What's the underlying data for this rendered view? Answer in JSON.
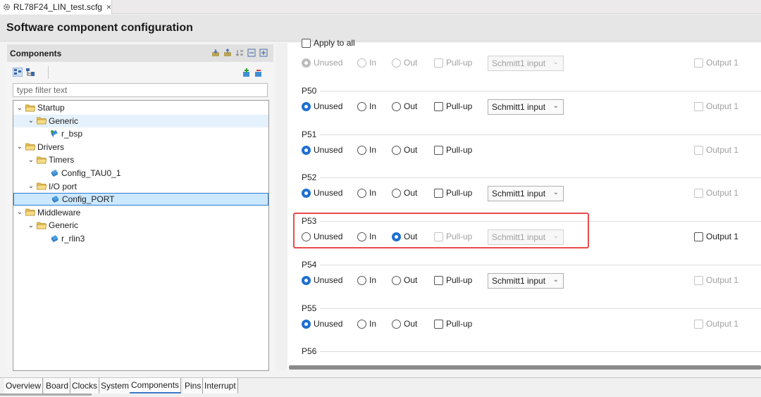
{
  "tab": {
    "title": "RL78F24_LIN_test.scfg",
    "close_symbol": "×"
  },
  "header": {
    "title": "Software component configuration"
  },
  "components": {
    "title": "Components",
    "filter_placeholder": "type filter text",
    "tree": [
      {
        "label": "Startup",
        "chev": "⌄",
        "kind": "folder"
      },
      {
        "label": "Generic",
        "chev": "⌄",
        "kind": "folder"
      },
      {
        "label": "r_bsp",
        "chev": "",
        "kind": "bsp"
      },
      {
        "label": "Drivers",
        "chev": "⌄",
        "kind": "folder"
      },
      {
        "label": "Timers",
        "chev": "⌄",
        "kind": "folder"
      },
      {
        "label": "Config_TAU0_1",
        "chev": "",
        "kind": "config"
      },
      {
        "label": "I/O port",
        "chev": "⌄",
        "kind": "folder"
      },
      {
        "label": "Config_PORT",
        "chev": "",
        "kind": "config"
      },
      {
        "label": "Middleware",
        "chev": "⌄",
        "kind": "folder"
      },
      {
        "label": "Generic",
        "chev": "⌄",
        "kind": "folder"
      },
      {
        "label": "r_rlin3",
        "chev": "",
        "kind": "config"
      }
    ]
  },
  "bottom_tabs": [
    "Overview",
    "Board",
    "Clocks",
    "System",
    "Components",
    "Pins",
    "Interrupt"
  ],
  "ports": {
    "apply_all_label": "Apply to all",
    "labels": {
      "unused": "Unused",
      "in": "In",
      "out": "Out",
      "pullup": "Pull-up",
      "output1": "Output 1",
      "schmitt": "Schmitt1 input"
    },
    "pins": [
      {
        "name": "",
        "mode": "unused",
        "has_dropdown": true,
        "enabled": false,
        "output_enabled": false
      },
      {
        "name": "P50",
        "mode": "unused",
        "has_dropdown": true,
        "enabled": true,
        "output_enabled": false
      },
      {
        "name": "P51",
        "mode": "unused",
        "has_dropdown": false,
        "enabled": true,
        "output_enabled": false
      },
      {
        "name": "P52",
        "mode": "unused",
        "has_dropdown": true,
        "enabled": true,
        "output_enabled": false
      },
      {
        "name": "P53",
        "mode": "out",
        "has_dropdown": true,
        "enabled": true,
        "output_enabled": true
      },
      {
        "name": "P54",
        "mode": "unused",
        "has_dropdown": true,
        "enabled": true,
        "output_enabled": false
      },
      {
        "name": "P55",
        "mode": "unused",
        "has_dropdown": false,
        "enabled": true,
        "output_enabled": false
      },
      {
        "name": "P56",
        "mode": "",
        "has_dropdown": false,
        "enabled": true,
        "output_enabled": false
      }
    ]
  },
  "colors": {
    "accent": "#1f6fd1",
    "highlight": "#e94b4b"
  }
}
